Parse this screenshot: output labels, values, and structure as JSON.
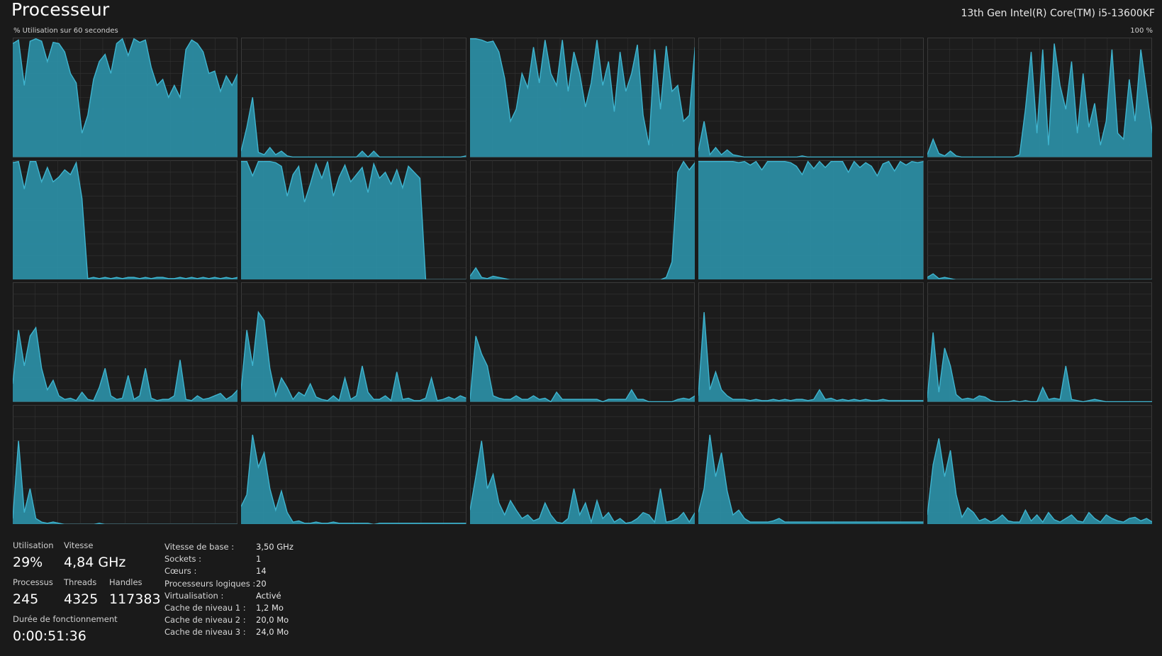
{
  "header": {
    "title": "Processeur",
    "cpu_name": "13th Gen Intel(R) Core(TM) i5-13600KF",
    "graph_caption": "% Utilisation sur 60 secondes",
    "graph_max": "100 %"
  },
  "colors": {
    "background": "#1a1a1a",
    "graph_line": "#3fb4cf",
    "graph_fill": "#2b8fa6",
    "grid": "#333333"
  },
  "cpu_graphs": [
    {
      "core": 0,
      "usage": [
        95,
        98,
        60,
        97,
        99,
        97,
        80,
        96,
        95,
        88,
        70,
        62,
        20,
        35,
        65,
        80,
        86,
        70,
        95,
        99,
        85,
        99,
        96,
        98,
        75,
        60,
        65,
        50,
        60,
        50,
        90,
        98,
        95,
        88,
        70,
        72,
        55,
        68,
        60,
        70
      ]
    },
    {
      "core": 1,
      "usage": [
        5,
        25,
        50,
        4,
        2,
        8,
        2,
        5,
        1,
        0,
        0,
        0,
        0,
        0,
        0,
        0,
        0,
        0,
        0,
        0,
        0,
        5,
        0,
        5,
        0,
        0,
        0,
        0,
        0,
        0,
        0,
        0,
        0,
        0,
        0,
        0,
        0,
        0,
        0,
        1
      ]
    },
    {
      "core": 2,
      "usage": [
        99,
        99,
        98,
        96,
        97,
        88,
        66,
        30,
        40,
        70,
        58,
        92,
        62,
        98,
        70,
        60,
        98,
        55,
        88,
        70,
        42,
        62,
        98,
        60,
        80,
        38,
        88,
        55,
        70,
        94,
        35,
        10,
        90,
        40,
        93,
        55,
        60,
        30,
        35,
        92
      ]
    },
    {
      "core": 3,
      "usage": [
        5,
        30,
        2,
        8,
        2,
        6,
        2,
        1,
        0,
        0,
        0,
        0,
        0,
        0,
        0,
        0,
        0,
        0,
        1,
        0,
        0,
        0,
        0,
        0,
        0,
        0,
        0,
        0,
        0,
        0,
        0,
        0,
        0,
        0,
        0,
        0,
        0,
        0,
        0,
        0
      ]
    },
    {
      "core": 4,
      "usage": [
        2,
        15,
        3,
        1,
        5,
        1,
        0,
        0,
        0,
        0,
        0,
        0,
        0,
        0,
        0,
        0,
        2,
        40,
        88,
        20,
        90,
        10,
        95,
        60,
        40,
        80,
        20,
        70,
        25,
        45,
        10,
        30,
        90,
        20,
        15,
        65,
        30,
        90,
        55,
        20
      ]
    },
    {
      "core": 5,
      "usage": [
        98,
        99,
        76,
        99,
        99,
        82,
        94,
        82,
        86,
        92,
        88,
        98,
        68,
        1,
        2,
        1,
        2,
        1,
        2,
        1,
        2,
        2,
        1,
        2,
        1,
        2,
        2,
        1,
        1,
        2,
        1,
        2,
        1,
        2,
        1,
        2,
        1,
        2,
        1,
        2
      ]
    },
    {
      "core": 6,
      "usage": [
        99,
        99,
        87,
        99,
        99,
        99,
        98,
        95,
        70,
        88,
        95,
        65,
        80,
        97,
        85,
        99,
        70,
        86,
        96,
        82,
        88,
        94,
        73,
        97,
        85,
        90,
        80,
        92,
        77,
        95,
        90,
        85,
        0,
        0,
        0,
        0,
        0,
        0,
        0,
        0
      ]
    },
    {
      "core": 7,
      "usage": [
        3,
        10,
        2,
        1,
        3,
        2,
        1,
        0,
        0,
        0,
        0,
        0,
        0,
        0,
        0,
        0,
        0,
        0,
        0,
        0,
        0,
        0,
        0,
        0,
        0,
        0,
        0,
        0,
        0,
        0,
        0,
        0,
        0,
        0,
        2,
        15,
        90,
        99,
        92,
        98
      ]
    },
    {
      "core": 8,
      "usage": [
        99,
        99,
        99,
        99,
        99,
        99,
        99,
        98,
        99,
        96,
        99,
        92,
        99,
        99,
        99,
        99,
        98,
        95,
        88,
        99,
        93,
        99,
        94,
        99,
        99,
        99,
        90,
        99,
        94,
        98,
        95,
        87,
        97,
        99,
        91,
        99,
        96,
        99,
        98,
        99
      ]
    },
    {
      "core": 9,
      "usage": [
        2,
        5,
        1,
        2,
        1,
        0,
        0,
        0,
        0,
        0,
        0,
        0,
        0,
        0,
        0,
        0,
        0,
        0,
        0,
        0,
        0,
        0,
        0,
        0,
        0,
        0,
        0,
        0,
        0,
        0,
        0,
        0,
        0,
        0,
        0,
        0,
        0,
        0,
        0,
        0
      ]
    },
    {
      "core": 10,
      "usage": [
        15,
        60,
        30,
        55,
        62,
        28,
        10,
        18,
        5,
        2,
        3,
        1,
        8,
        2,
        1,
        12,
        28,
        5,
        2,
        3,
        22,
        2,
        5,
        28,
        3,
        1,
        2,
        2,
        5,
        35,
        2,
        1,
        5,
        2,
        3,
        5,
        7,
        2,
        5,
        10
      ]
    },
    {
      "core": 11,
      "usage": [
        10,
        60,
        30,
        75,
        68,
        28,
        5,
        20,
        12,
        2,
        8,
        5,
        15,
        4,
        2,
        1,
        5,
        1,
        20,
        2,
        5,
        30,
        8,
        2,
        2,
        5,
        1,
        25,
        2,
        3,
        1,
        1,
        3,
        20,
        1,
        2,
        4,
        2,
        5,
        3
      ]
    },
    {
      "core": 12,
      "usage": [
        2,
        55,
        40,
        30,
        5,
        3,
        2,
        2,
        5,
        2,
        2,
        5,
        2,
        3,
        0,
        8,
        2,
        2,
        2,
        2,
        2,
        2,
        2,
        0,
        2,
        2,
        2,
        2,
        10,
        2,
        2,
        0,
        0,
        0,
        0,
        0,
        2,
        3,
        2,
        5
      ]
    },
    {
      "core": 13,
      "usage": [
        5,
        75,
        10,
        25,
        10,
        5,
        2,
        2,
        2,
        1,
        2,
        1,
        1,
        2,
        1,
        2,
        1,
        2,
        2,
        1,
        2,
        10,
        2,
        3,
        1,
        2,
        1,
        2,
        1,
        2,
        1,
        1,
        2,
        1,
        1,
        1,
        1,
        1,
        1,
        1
      ]
    },
    {
      "core": 14,
      "usage": [
        3,
        58,
        8,
        45,
        30,
        6,
        2,
        3,
        2,
        5,
        4,
        1,
        0,
        0,
        0,
        1,
        0,
        1,
        0,
        0,
        12,
        2,
        3,
        2,
        30,
        2,
        1,
        0,
        1,
        2,
        1,
        0,
        0,
        0,
        0,
        0,
        0,
        0,
        0,
        0
      ]
    },
    {
      "core": 15,
      "usage": [
        5,
        70,
        10,
        30,
        5,
        2,
        1,
        2,
        1,
        0,
        0,
        0,
        0,
        0,
        0,
        1,
        0,
        0,
        0,
        0,
        0,
        0,
        0,
        0,
        0,
        0,
        0,
        0,
        0,
        0,
        0,
        0,
        0,
        0,
        0,
        0,
        0,
        0,
        0,
        0
      ]
    },
    {
      "core": 16,
      "usage": [
        15,
        25,
        75,
        48,
        60,
        30,
        12,
        28,
        10,
        2,
        3,
        1,
        1,
        2,
        1,
        1,
        2,
        1,
        1,
        1,
        1,
        1,
        1,
        0,
        1,
        1,
        1,
        1,
        1,
        1,
        1,
        1,
        1,
        1,
        1,
        1,
        1,
        1,
        1,
        1
      ]
    },
    {
      "core": 17,
      "usage": [
        12,
        40,
        70,
        30,
        42,
        18,
        8,
        20,
        12,
        5,
        8,
        3,
        5,
        18,
        8,
        2,
        1,
        5,
        30,
        8,
        18,
        2,
        20,
        5,
        10,
        2,
        5,
        1,
        2,
        5,
        10,
        8,
        2,
        30,
        2,
        3,
        5,
        10,
        2,
        10
      ]
    },
    {
      "core": 18,
      "usage": [
        10,
        30,
        75,
        40,
        60,
        28,
        8,
        12,
        5,
        2,
        2,
        2,
        2,
        3,
        5,
        2,
        2,
        2,
        2,
        2,
        2,
        2,
        2,
        2,
        2,
        2,
        2,
        2,
        2,
        2,
        2,
        2,
        2,
        2,
        2,
        2,
        2,
        2,
        2,
        2
      ]
    },
    {
      "core": 19,
      "usage": [
        8,
        50,
        72,
        40,
        62,
        25,
        6,
        14,
        10,
        3,
        5,
        2,
        4,
        8,
        3,
        2,
        2,
        12,
        3,
        8,
        2,
        10,
        4,
        2,
        5,
        8,
        3,
        2,
        10,
        5,
        2,
        8,
        5,
        3,
        2,
        5,
        6,
        3,
        5,
        2
      ]
    }
  ],
  "stats": {
    "utilisation": {
      "label": "Utilisation",
      "value": "29%"
    },
    "vitesse": {
      "label": "Vitesse",
      "value": "4,84 GHz"
    },
    "processus": {
      "label": "Processus",
      "value": "245"
    },
    "threads": {
      "label": "Threads",
      "value": "4325"
    },
    "handles": {
      "label": "Handles",
      "value": "117383"
    },
    "uptime": {
      "label": "Durée de fonctionnement",
      "value": "0:00:51:36"
    }
  },
  "specs": [
    {
      "key": "Vitesse de base :",
      "value": "3,50 GHz"
    },
    {
      "key": "Sockets :",
      "value": "1"
    },
    {
      "key": "Cœurs :",
      "value": "14"
    },
    {
      "key": "Processeurs logiques :",
      "value": "20"
    },
    {
      "key": "Virtualisation :",
      "value": "Activé"
    },
    {
      "key": "Cache de niveau 1 :",
      "value": "1,2 Mo"
    },
    {
      "key": "Cache de niveau 2 :",
      "value": "20,0 Mo"
    },
    {
      "key": "Cache de niveau 3 :",
      "value": "24,0 Mo"
    }
  ]
}
